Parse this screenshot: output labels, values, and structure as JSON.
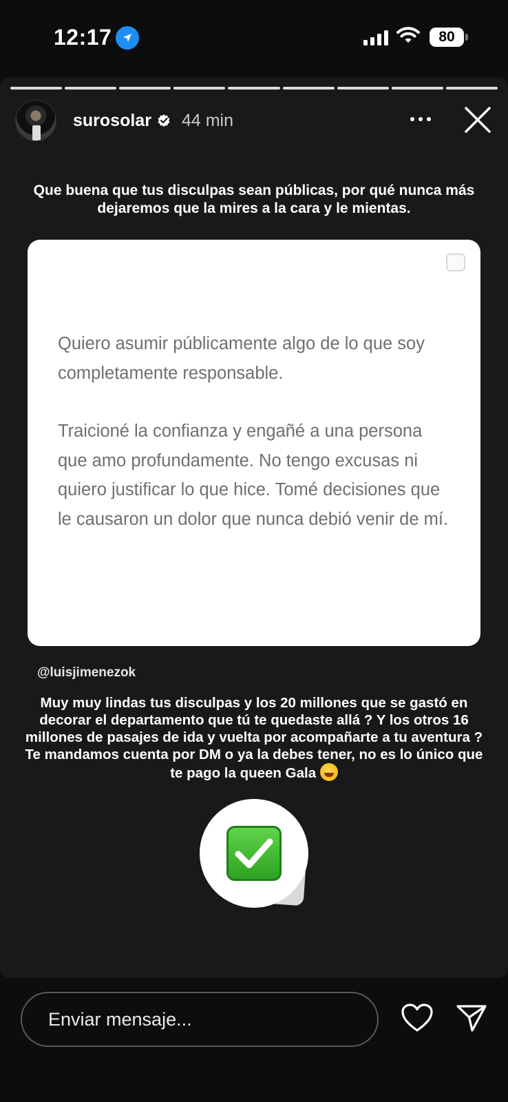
{
  "status_bar": {
    "time": "12:17",
    "battery": "80"
  },
  "story": {
    "username": "surosolar",
    "time_ago": "44 min",
    "segments": 9,
    "top_caption": "Que buena que tus disculpas sean públicas, por qué nunca más dejaremos que la mires a la cara y le mientas.",
    "card_paragraph_1": "Quiero asumir públicamente algo de lo que soy completamente responsable.",
    "card_paragraph_2": "Traicioné la confianza y engañé a una persona que amo profundamente. No tengo excusas ni quiero justificar lo que hice. Tomé decisiones que le causaron un dolor que nunca debió venir de mí.",
    "mention": "@luisjimenezok",
    "bottom_caption": "Muy muy lindas tus disculpas y los 20 millones que se gastó en decorar el departamento que tú te quedaste allá ? Y los otros 16 millones de pasajes de ida y vuelta por acompañarte a tu aventura ? Te mandamos cuenta por DM o ya la debes tener, no es lo único que te pago la queen Gala",
    "sticker_icon": "check-mark-button-emoji"
  },
  "footer": {
    "message_placeholder": "Enviar mensaje..."
  }
}
